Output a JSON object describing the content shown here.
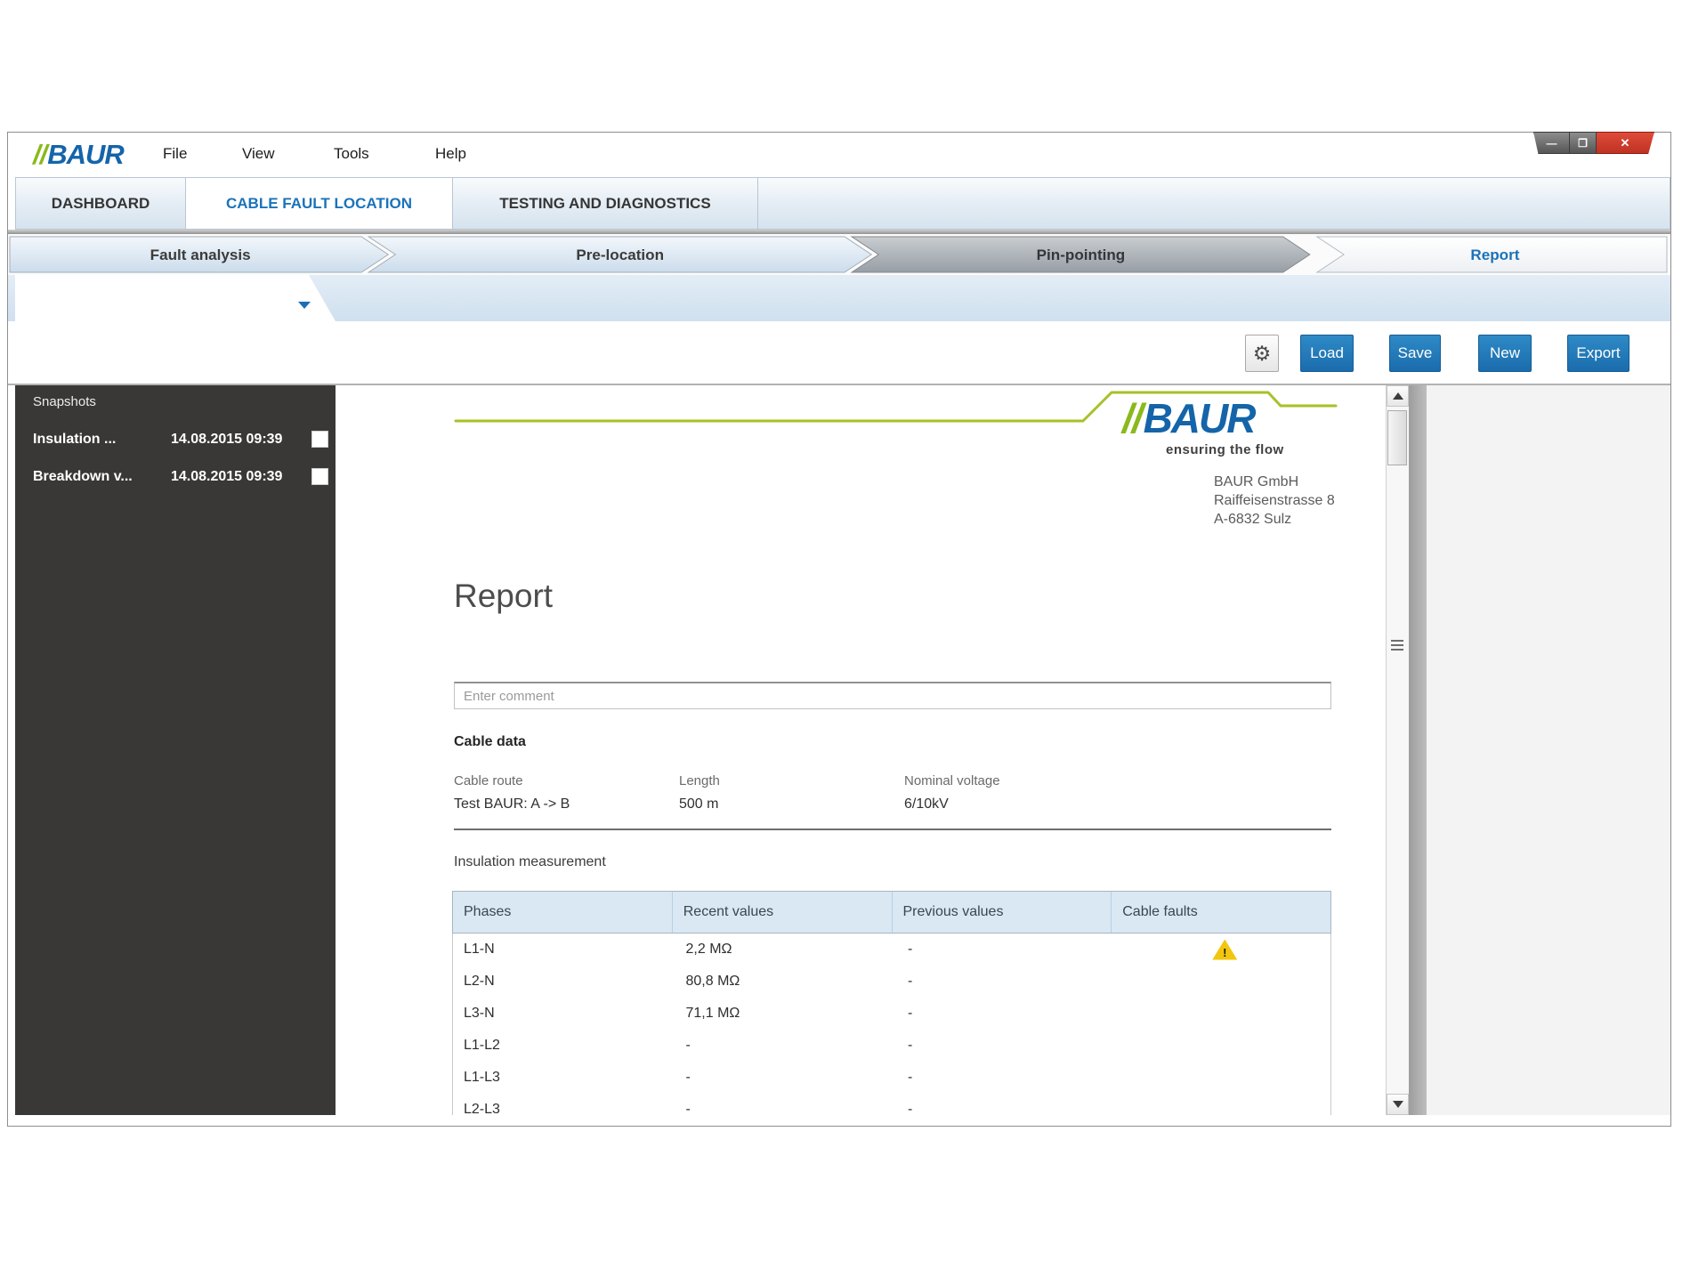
{
  "logo": {
    "slashes": "//",
    "text": "BAUR",
    "tagline": "ensuring the flow"
  },
  "menubar": {
    "items": [
      "File",
      "View",
      "Tools",
      "Help"
    ]
  },
  "window_controls": {
    "minimize": "—",
    "maximize": "❐",
    "close": "✕"
  },
  "tabs": [
    {
      "label": "DASHBOARD",
      "active": false
    },
    {
      "label": "CABLE FAULT LOCATION",
      "active": true
    },
    {
      "label": "TESTING AND DIAGNOSTICS",
      "active": false
    }
  ],
  "breadcrumb": [
    {
      "label": "Fault analysis"
    },
    {
      "label": "Pre-location"
    },
    {
      "label": "Pin-pointing"
    },
    {
      "label": "Report"
    }
  ],
  "toolbar": {
    "settings_glyph": "⚙",
    "load": "Load",
    "save": "Save",
    "new": "New",
    "export": "Export"
  },
  "sidebar": {
    "title": "Snapshots",
    "items": [
      {
        "name": "Insulation ...",
        "date": "14.08.2015 09:39"
      },
      {
        "name": "Breakdown v...",
        "date": "14.08.2015 09:39"
      }
    ]
  },
  "report": {
    "company": {
      "name": "BAUR GmbH",
      "street": "Raiffeisenstrasse 8",
      "city": "A-6832 Sulz"
    },
    "title": "Report",
    "comment_placeholder": "Enter comment",
    "cable_data": {
      "heading": "Cable data",
      "fields": [
        {
          "label": "Cable route",
          "value": "Test BAUR: A -> B"
        },
        {
          "label": "Length",
          "value": "500 m"
        },
        {
          "label": "Nominal voltage",
          "value": "6/10kV"
        }
      ]
    },
    "insulation": {
      "heading": "Insulation measurement",
      "warning_glyph": "!",
      "columns": [
        "Phases",
        "Recent values",
        "Previous values",
        "Cable faults"
      ],
      "rows": [
        {
          "phase": "L1-N",
          "recent": "2,2 MΩ",
          "previous": "-",
          "fault": true
        },
        {
          "phase": "L2-N",
          "recent": "80,8 MΩ",
          "previous": "-",
          "fault": false
        },
        {
          "phase": "L3-N",
          "recent": "71,1 MΩ",
          "previous": "-",
          "fault": false
        },
        {
          "phase": "L1-L2",
          "recent": "-",
          "previous": "-",
          "fault": false
        },
        {
          "phase": "L1-L3",
          "recent": "-",
          "previous": "-",
          "fault": false
        },
        {
          "phase": "L2-L3",
          "recent": "-",
          "previous": "-",
          "fault": false
        }
      ]
    }
  },
  "colors": {
    "accent_blue": "#1a73ba",
    "button_blue": "#1b6cac",
    "baur_green": "#a6c226",
    "logo_green": "#8ab91d",
    "logo_blue": "#1464aa",
    "sidebar_dark": "#3a3836",
    "table_header_blue": "#d9e8f3",
    "warning_yellow": "#f2c60e",
    "close_red": "#bf3222"
  }
}
